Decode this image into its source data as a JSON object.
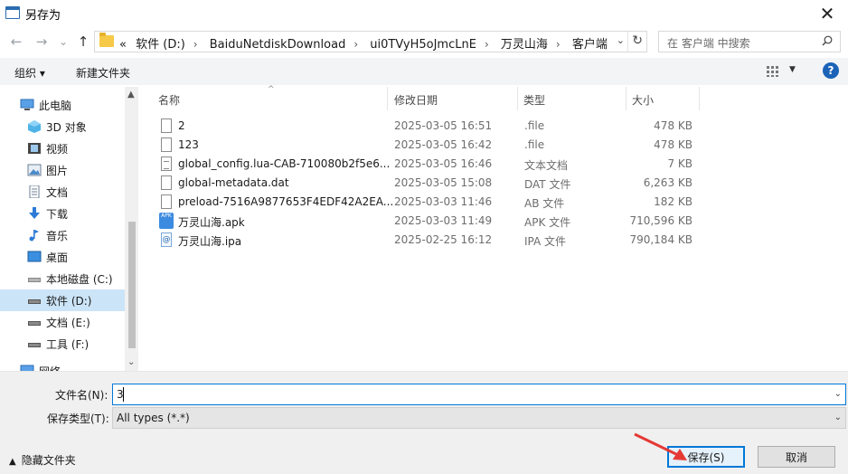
{
  "window": {
    "title": "另存为",
    "close_glyph": "✕"
  },
  "nav": {
    "back_glyph": "←",
    "forward_glyph": "→",
    "recent_glyph": "⌄",
    "up_glyph": "↑",
    "breadcrumb_prefix": "«",
    "breadcrumbs": [
      "软件 (D:)",
      "BaiduNetdiskDownload",
      "ui0TVyH5oJmcLnE",
      "万灵山海",
      "客户端"
    ],
    "crumb_sep": "›",
    "dropdown_glyph": "⌄",
    "refresh_glyph": "↻"
  },
  "search": {
    "placeholder": "在 客户端 中搜索"
  },
  "toolbar": {
    "organize": "组织 ▾",
    "new_folder": "新建文件夹",
    "help": "?"
  },
  "sidebar": {
    "items": [
      {
        "label": "此电脑",
        "icon": "computer-icon"
      },
      {
        "label": "3D 对象",
        "icon": "3d-objects-icon"
      },
      {
        "label": "视频",
        "icon": "video-icon"
      },
      {
        "label": "图片",
        "icon": "pictures-icon"
      },
      {
        "label": "文档",
        "icon": "documents-icon"
      },
      {
        "label": "下载",
        "icon": "download-icon"
      },
      {
        "label": "音乐",
        "icon": "music-icon"
      },
      {
        "label": "桌面",
        "icon": "desktop-icon"
      },
      {
        "label": "本地磁盘 (C:)",
        "icon": "drive-icon"
      },
      {
        "label": "软件 (D:)",
        "icon": "drive-icon"
      },
      {
        "label": "文档 (E:)",
        "icon": "drive-icon"
      },
      {
        "label": "工具 (F:)",
        "icon": "drive-icon"
      },
      {
        "label": "网络",
        "icon": "network-icon"
      }
    ],
    "selected": "软件 (D:)"
  },
  "columns": {
    "name": "名称",
    "modified": "修改日期",
    "type": "类型",
    "size": "大小"
  },
  "files": [
    {
      "name": "2",
      "modified": "2025-03-05 16:51",
      "type": ".file",
      "size": "478 KB",
      "icon": "file-icon"
    },
    {
      "name": "123",
      "modified": "2025-03-05 16:42",
      "type": ".file",
      "size": "478 KB",
      "icon": "file-icon"
    },
    {
      "name": "global_config.lua-CAB-710080b2f5e6...",
      "modified": "2025-03-05 16:46",
      "type": "文本文档",
      "size": "7 KB",
      "icon": "text-file-icon"
    },
    {
      "name": "global-metadata.dat",
      "modified": "2025-03-05 15:08",
      "type": "DAT 文件",
      "size": "6,263 KB",
      "icon": "file-icon"
    },
    {
      "name": "preload-7516A9877653F4EDF42A2EA...",
      "modified": "2025-03-03 11:46",
      "type": "AB 文件",
      "size": "182 KB",
      "icon": "file-icon"
    },
    {
      "name": "万灵山海.apk",
      "modified": "2025-03-03 11:49",
      "type": "APK 文件",
      "size": "710,596 KB",
      "icon": "apk-icon"
    },
    {
      "name": "万灵山海.ipa",
      "modified": "2025-02-25 16:12",
      "type": "IPA 文件",
      "size": "790,184 KB",
      "icon": "ipa-icon"
    }
  ],
  "bottom": {
    "filename_label": "文件名(N):",
    "filename_value": "3",
    "filetype_label": "保存类型(T):",
    "filetype_value": "All types (*.*)",
    "hide_folders": "隐藏文件夹",
    "save": "保存(S)",
    "cancel": "取消"
  },
  "colors": {
    "accent": "#0078d7",
    "selected_bg": "#cce4f7",
    "annotation_arrow": "#e53935"
  }
}
